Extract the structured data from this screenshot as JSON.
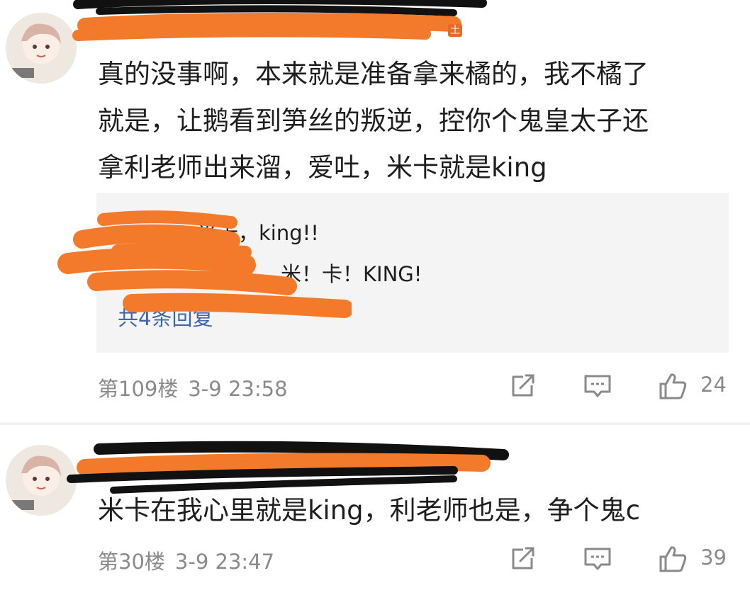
{
  "comments": [
    {
      "badge": "土",
      "body": "真的没事啊，本来就是准备拿来橘的，我不橘了\n就是，让鹅看到笋丝的叛逆，控你个鬼皇太子还\n拿利老师出来溜，爱吐，米卡就是king",
      "replies": [
        "米卡，king!!",
        "米！卡！KING!"
      ],
      "reply_count": "共4条回复",
      "floor": "第109楼",
      "time": "3-9 23:58",
      "likes": "24"
    },
    {
      "body": "米卡在我心里就是king，利老师也是，争个鬼c",
      "floor": "第30楼",
      "time": "3-9 23:47",
      "likes": "39"
    }
  ],
  "icons": {
    "share": "share-icon",
    "reply": "comment-icon",
    "like": "thumbs-up-icon"
  },
  "colors": {
    "redaction_orange": "#f47a2b",
    "redaction_black": "#111111",
    "link_blue": "#3f67a8",
    "meta_gray": "#8a8a8a"
  }
}
